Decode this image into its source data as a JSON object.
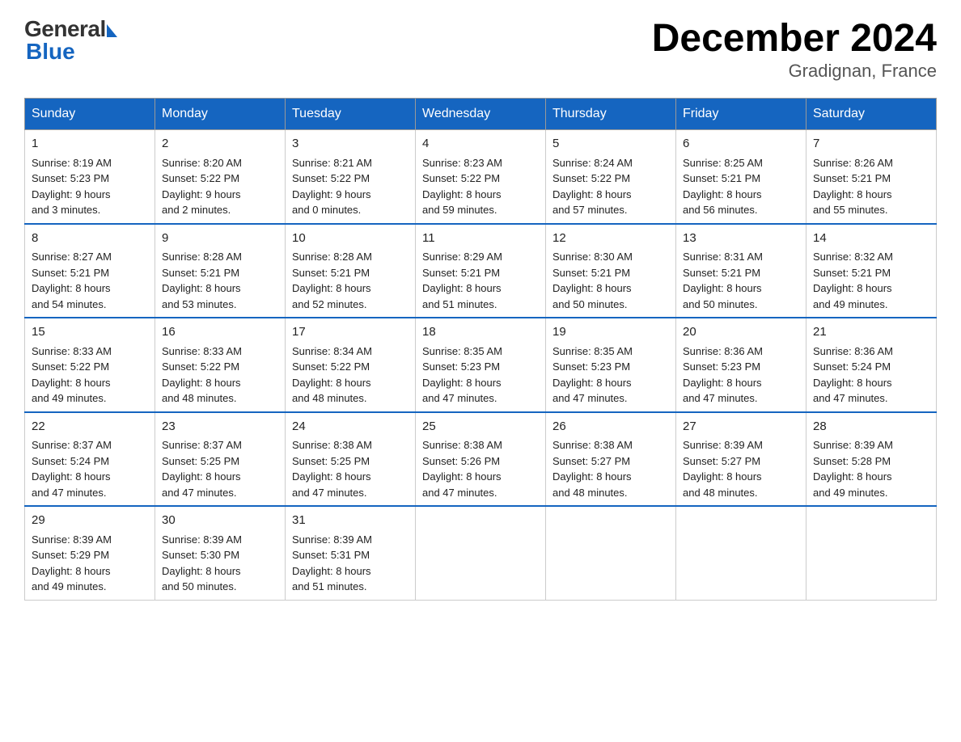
{
  "logo": {
    "general": "General",
    "blue": "Blue"
  },
  "title": "December 2024",
  "location": "Gradignan, France",
  "headers": [
    "Sunday",
    "Monday",
    "Tuesday",
    "Wednesday",
    "Thursday",
    "Friday",
    "Saturday"
  ],
  "weeks": [
    [
      {
        "day": "1",
        "sunrise": "8:19 AM",
        "sunset": "5:23 PM",
        "daylight": "9 hours and 3 minutes."
      },
      {
        "day": "2",
        "sunrise": "8:20 AM",
        "sunset": "5:22 PM",
        "daylight": "9 hours and 2 minutes."
      },
      {
        "day": "3",
        "sunrise": "8:21 AM",
        "sunset": "5:22 PM",
        "daylight": "9 hours and 0 minutes."
      },
      {
        "day": "4",
        "sunrise": "8:23 AM",
        "sunset": "5:22 PM",
        "daylight": "8 hours and 59 minutes."
      },
      {
        "day": "5",
        "sunrise": "8:24 AM",
        "sunset": "5:22 PM",
        "daylight": "8 hours and 57 minutes."
      },
      {
        "day": "6",
        "sunrise": "8:25 AM",
        "sunset": "5:21 PM",
        "daylight": "8 hours and 56 minutes."
      },
      {
        "day": "7",
        "sunrise": "8:26 AM",
        "sunset": "5:21 PM",
        "daylight": "8 hours and 55 minutes."
      }
    ],
    [
      {
        "day": "8",
        "sunrise": "8:27 AM",
        "sunset": "5:21 PM",
        "daylight": "8 hours and 54 minutes."
      },
      {
        "day": "9",
        "sunrise": "8:28 AM",
        "sunset": "5:21 PM",
        "daylight": "8 hours and 53 minutes."
      },
      {
        "day": "10",
        "sunrise": "8:28 AM",
        "sunset": "5:21 PM",
        "daylight": "8 hours and 52 minutes."
      },
      {
        "day": "11",
        "sunrise": "8:29 AM",
        "sunset": "5:21 PM",
        "daylight": "8 hours and 51 minutes."
      },
      {
        "day": "12",
        "sunrise": "8:30 AM",
        "sunset": "5:21 PM",
        "daylight": "8 hours and 50 minutes."
      },
      {
        "day": "13",
        "sunrise": "8:31 AM",
        "sunset": "5:21 PM",
        "daylight": "8 hours and 50 minutes."
      },
      {
        "day": "14",
        "sunrise": "8:32 AM",
        "sunset": "5:21 PM",
        "daylight": "8 hours and 49 minutes."
      }
    ],
    [
      {
        "day": "15",
        "sunrise": "8:33 AM",
        "sunset": "5:22 PM",
        "daylight": "8 hours and 49 minutes."
      },
      {
        "day": "16",
        "sunrise": "8:33 AM",
        "sunset": "5:22 PM",
        "daylight": "8 hours and 48 minutes."
      },
      {
        "day": "17",
        "sunrise": "8:34 AM",
        "sunset": "5:22 PM",
        "daylight": "8 hours and 48 minutes."
      },
      {
        "day": "18",
        "sunrise": "8:35 AM",
        "sunset": "5:23 PM",
        "daylight": "8 hours and 47 minutes."
      },
      {
        "day": "19",
        "sunrise": "8:35 AM",
        "sunset": "5:23 PM",
        "daylight": "8 hours and 47 minutes."
      },
      {
        "day": "20",
        "sunrise": "8:36 AM",
        "sunset": "5:23 PM",
        "daylight": "8 hours and 47 minutes."
      },
      {
        "day": "21",
        "sunrise": "8:36 AM",
        "sunset": "5:24 PM",
        "daylight": "8 hours and 47 minutes."
      }
    ],
    [
      {
        "day": "22",
        "sunrise": "8:37 AM",
        "sunset": "5:24 PM",
        "daylight": "8 hours and 47 minutes."
      },
      {
        "day": "23",
        "sunrise": "8:37 AM",
        "sunset": "5:25 PM",
        "daylight": "8 hours and 47 minutes."
      },
      {
        "day": "24",
        "sunrise": "8:38 AM",
        "sunset": "5:25 PM",
        "daylight": "8 hours and 47 minutes."
      },
      {
        "day": "25",
        "sunrise": "8:38 AM",
        "sunset": "5:26 PM",
        "daylight": "8 hours and 47 minutes."
      },
      {
        "day": "26",
        "sunrise": "8:38 AM",
        "sunset": "5:27 PM",
        "daylight": "8 hours and 48 minutes."
      },
      {
        "day": "27",
        "sunrise": "8:39 AM",
        "sunset": "5:27 PM",
        "daylight": "8 hours and 48 minutes."
      },
      {
        "day": "28",
        "sunrise": "8:39 AM",
        "sunset": "5:28 PM",
        "daylight": "8 hours and 49 minutes."
      }
    ],
    [
      {
        "day": "29",
        "sunrise": "8:39 AM",
        "sunset": "5:29 PM",
        "daylight": "8 hours and 49 minutes."
      },
      {
        "day": "30",
        "sunrise": "8:39 AM",
        "sunset": "5:30 PM",
        "daylight": "8 hours and 50 minutes."
      },
      {
        "day": "31",
        "sunrise": "8:39 AM",
        "sunset": "5:31 PM",
        "daylight": "8 hours and 51 minutes."
      },
      null,
      null,
      null,
      null
    ]
  ]
}
